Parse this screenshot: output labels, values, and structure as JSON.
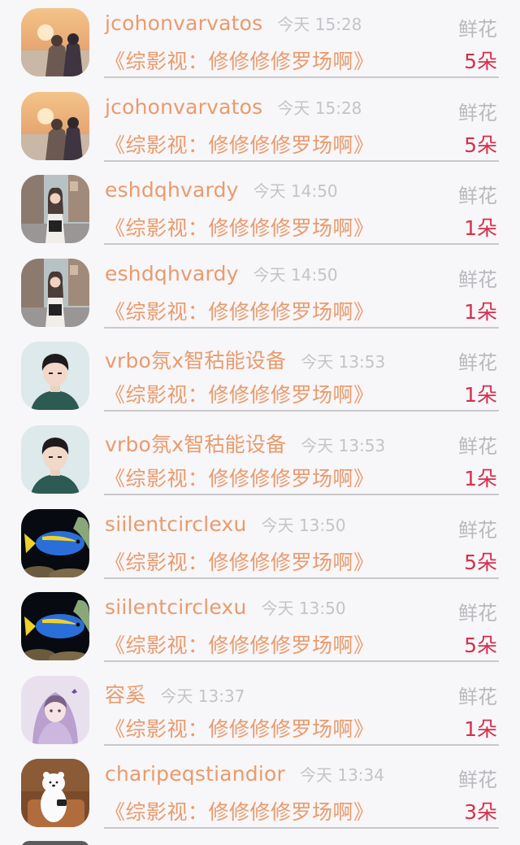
{
  "gift_list": {
    "items": [
      {
        "username": "jcohonvarvatos",
        "time": "今天 15:28",
        "gift_name": "鲜花",
        "subtitle": "《综影视：修修修修罗场啊》",
        "count": "5朵",
        "avatar": "couple-sunset"
      },
      {
        "username": "jcohonvarvatos",
        "time": "今天 15:28",
        "gift_name": "鲜花",
        "subtitle": "《综影视：修修修修罗场啊》",
        "count": "5朵",
        "avatar": "couple-sunset"
      },
      {
        "username": "eshdqhvardy",
        "time": "今天 14:50",
        "gift_name": "鲜花",
        "subtitle": "《综影视：修修修修罗场啊》",
        "count": "1朵",
        "avatar": "girl-street"
      },
      {
        "username": "eshdqhvardy",
        "time": "今天 14:50",
        "gift_name": "鲜花",
        "subtitle": "《综影视：修修修修罗场啊》",
        "count": "1朵",
        "avatar": "girl-street"
      },
      {
        "username": "vrbo氛x智秙能设备",
        "time": "今天 13:53",
        "gift_name": "鲜花",
        "subtitle": "《综影视：修修修修罗场啊》",
        "count": "1朵",
        "avatar": "boy-portrait"
      },
      {
        "username": "vrbo氛x智秙能设备",
        "time": "今天 13:53",
        "gift_name": "鲜花",
        "subtitle": "《综影视：修修修修罗场啊》",
        "count": "1朵",
        "avatar": "boy-portrait"
      },
      {
        "username": "siilentcirclexu",
        "time": "今天 13:50",
        "gift_name": "鲜花",
        "subtitle": "《综影视：修修修修罗场啊》",
        "count": "5朵",
        "avatar": "blue-fish"
      },
      {
        "username": "siilentcirclexu",
        "time": "今天 13:50",
        "gift_name": "鲜花",
        "subtitle": "《综影视：修修修修罗场啊》",
        "count": "5朵",
        "avatar": "blue-fish"
      },
      {
        "username": "容奚",
        "time": "今天 13:37",
        "gift_name": "鲜花",
        "subtitle": "《综影视：修修修修罗场啊》",
        "count": "1朵",
        "avatar": "anime-girl"
      },
      {
        "username": "charipeqstiandior",
        "time": "今天 13:34",
        "gift_name": "鲜花",
        "subtitle": "《综影视：修修修修罗场啊》",
        "count": "3朵",
        "avatar": "cartoon-bear"
      }
    ]
  },
  "colors": {
    "background": "#f7f6f9",
    "username": "#e99b6c",
    "count": "#d4304b",
    "muted": "#c4c4c8"
  }
}
